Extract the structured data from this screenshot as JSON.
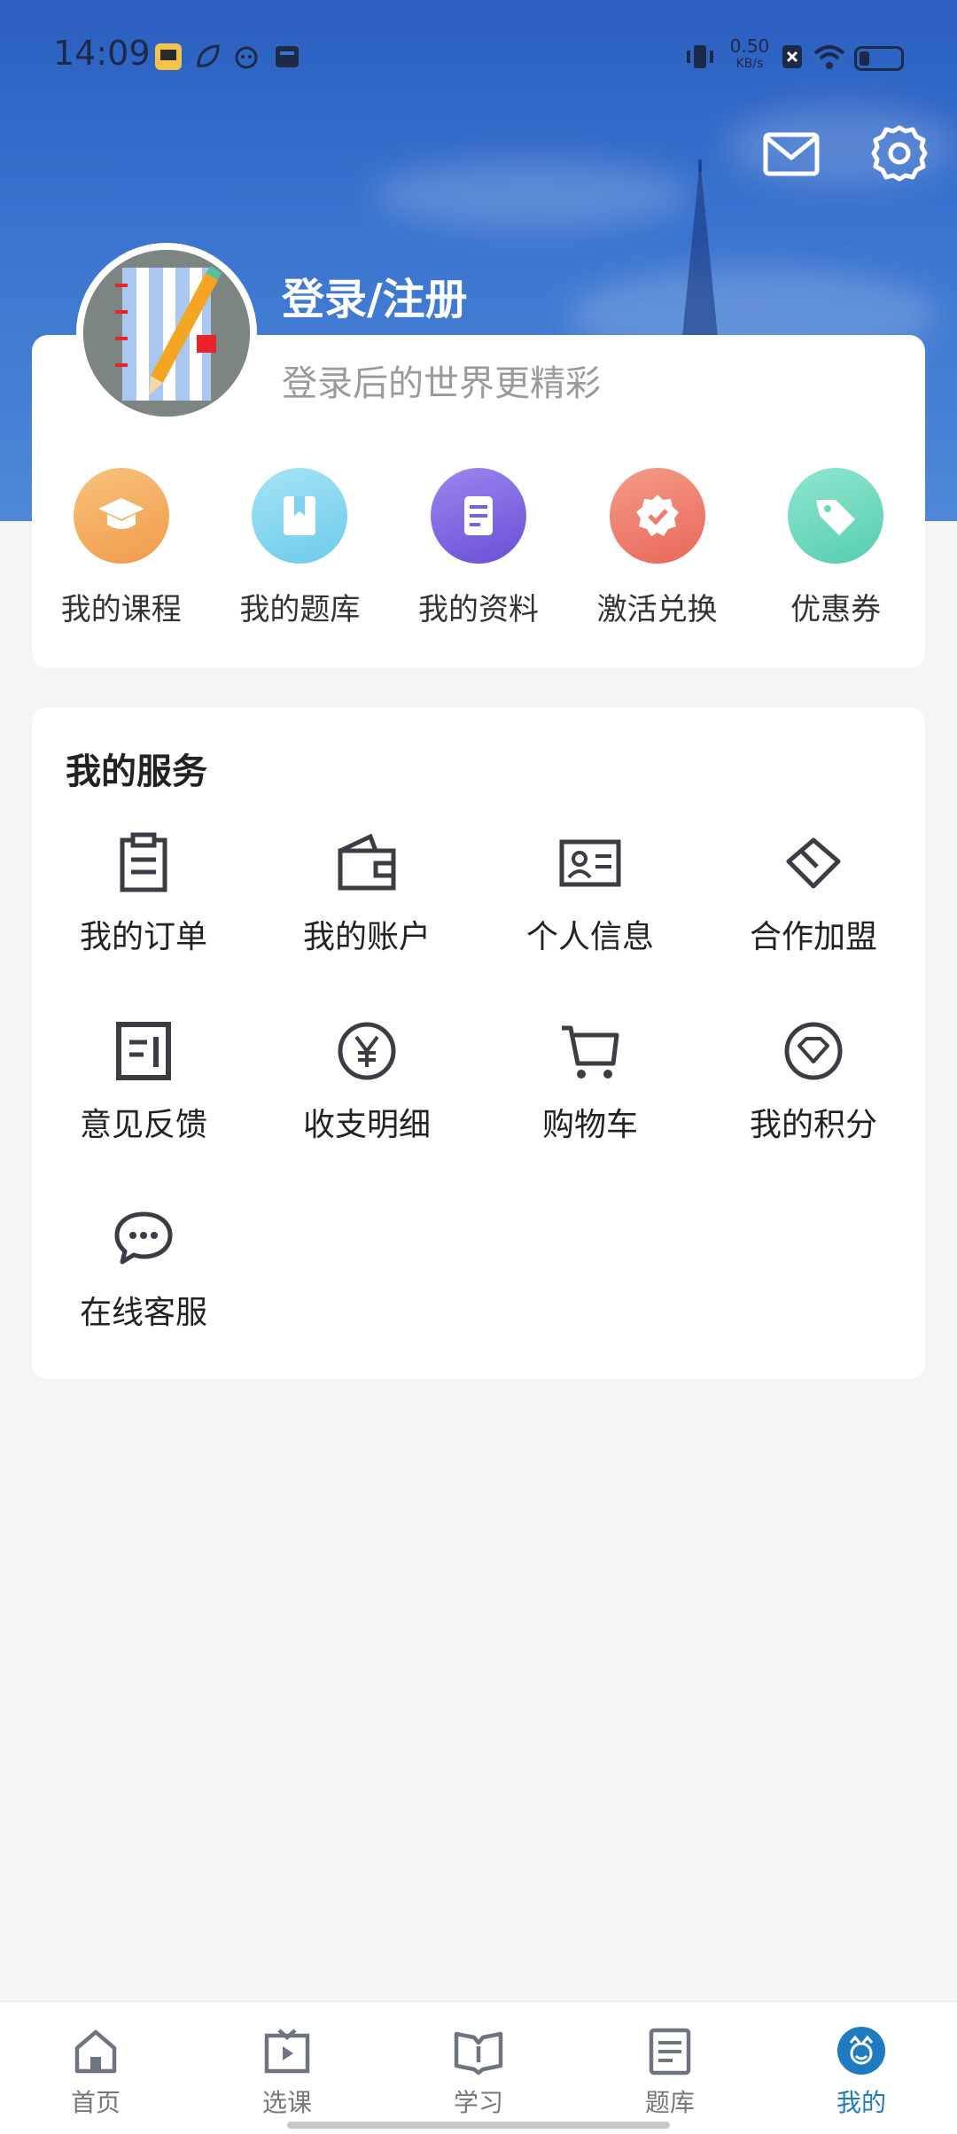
{
  "status_bar": {
    "time": "14:09",
    "net_speed_value": "0.50",
    "net_speed_unit": "KB/s",
    "battery_level": 0.25
  },
  "header": {
    "login_title": "登录/注册",
    "login_subtitle": "登录后的世界更精彩"
  },
  "shortcuts": [
    {
      "label": "我的课程",
      "icon": "graduation-cap-icon",
      "color": "#f4a95c"
    },
    {
      "label": "我的题库",
      "icon": "question-book-icon",
      "color": "#7fd3ee"
    },
    {
      "label": "我的资料",
      "icon": "document-icon",
      "color": "#7a62dc"
    },
    {
      "label": "激活兑换",
      "icon": "activation-badge-icon",
      "color": "#ef7a6b"
    },
    {
      "label": "优惠券",
      "icon": "coupon-tag-icon",
      "color": "#6cd8bf"
    }
  ],
  "services": {
    "title": "我的服务",
    "items": [
      {
        "label": "我的订单",
        "icon": "clipboard-icon"
      },
      {
        "label": "我的账户",
        "icon": "wallet-icon"
      },
      {
        "label": "个人信息",
        "icon": "id-card-icon"
      },
      {
        "label": "合作加盟",
        "icon": "partnership-diamond-icon"
      },
      {
        "label": "意见反馈",
        "icon": "feedback-icon"
      },
      {
        "label": "收支明细",
        "icon": "yen-coin-icon"
      },
      {
        "label": "购物车",
        "icon": "shopping-cart-icon"
      },
      {
        "label": "我的积分",
        "icon": "points-gem-icon"
      },
      {
        "label": "在线客服",
        "icon": "chat-bubble-icon"
      }
    ]
  },
  "bottom_nav": [
    {
      "label": "首页",
      "icon": "home-icon",
      "active": false
    },
    {
      "label": "选课",
      "icon": "course-select-icon",
      "active": false
    },
    {
      "label": "学习",
      "icon": "open-book-icon",
      "active": false
    },
    {
      "label": "题库",
      "icon": "question-bank-icon",
      "active": false
    },
    {
      "label": "我的",
      "icon": "profile-face-icon",
      "active": true
    }
  ],
  "colors": {
    "header_blue": "#2b5fc0",
    "active_nav": "#1f7bc0",
    "icon_stroke": "#3a3d45"
  }
}
